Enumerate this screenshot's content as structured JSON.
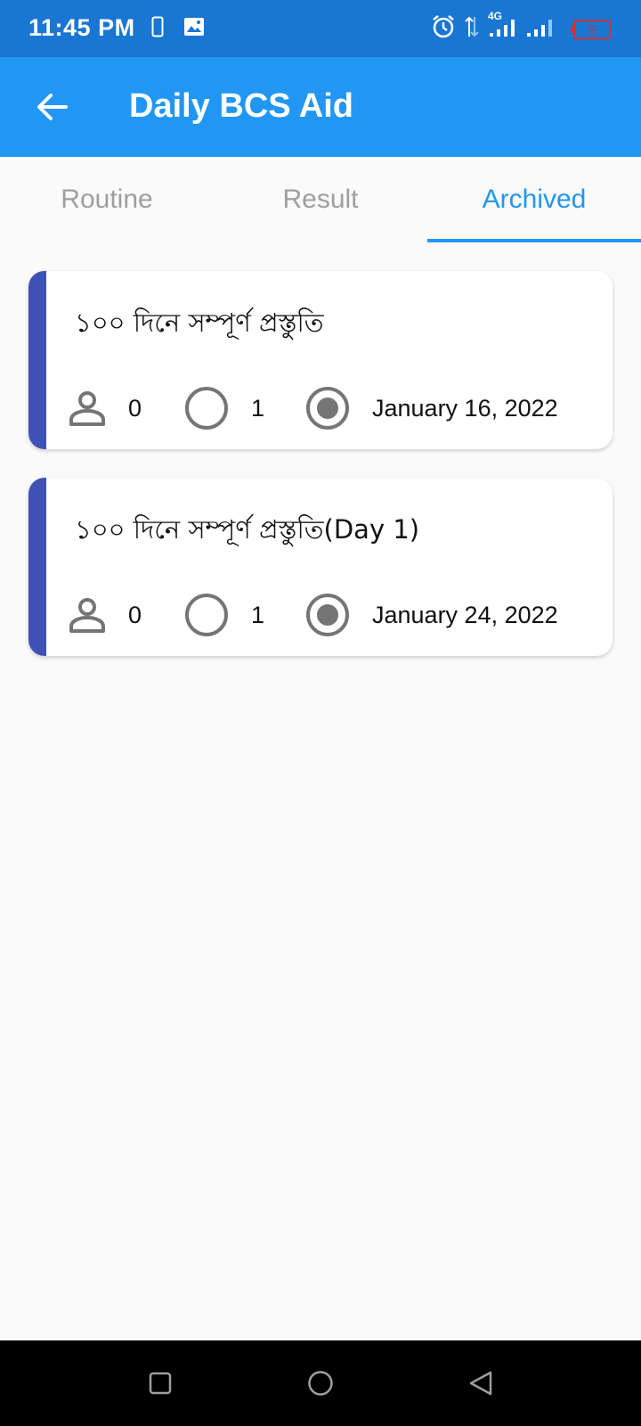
{
  "status_bar": {
    "time": "11:45 PM",
    "network": "4G",
    "battery_level": "5",
    "icons": [
      "phone-icon",
      "image-icon",
      "alarm-icon",
      "data-arrows-icon",
      "signal-icon",
      "battery-icon"
    ]
  },
  "app_bar": {
    "title": "Daily BCS Aid",
    "back_icon": "arrow-back-icon"
  },
  "tabs": [
    {
      "label": "Routine",
      "active": false
    },
    {
      "label": "Result",
      "active": false
    },
    {
      "label": "Archived",
      "active": true
    }
  ],
  "colors": {
    "status_bar": "#1976d2",
    "app_bar": "#2196f3",
    "accent": "#3f51b5",
    "tab_active": "#2196f3",
    "tab_inactive": "#9e9e9e"
  },
  "cards": [
    {
      "title": "১০০ দিনে সম্পূর্ণ প্রস্তুতি",
      "participants": "0",
      "pending": "1",
      "date": "January 16, 2022"
    },
    {
      "title": "১০০ দিনে সম্পূর্ণ প্রস্তুতি(Day 1)",
      "participants": "0",
      "pending": "1",
      "date": "January 24, 2022"
    }
  ],
  "nav_bar": {
    "icons": [
      "recents-square-icon",
      "home-circle-icon",
      "back-triangle-icon"
    ]
  }
}
